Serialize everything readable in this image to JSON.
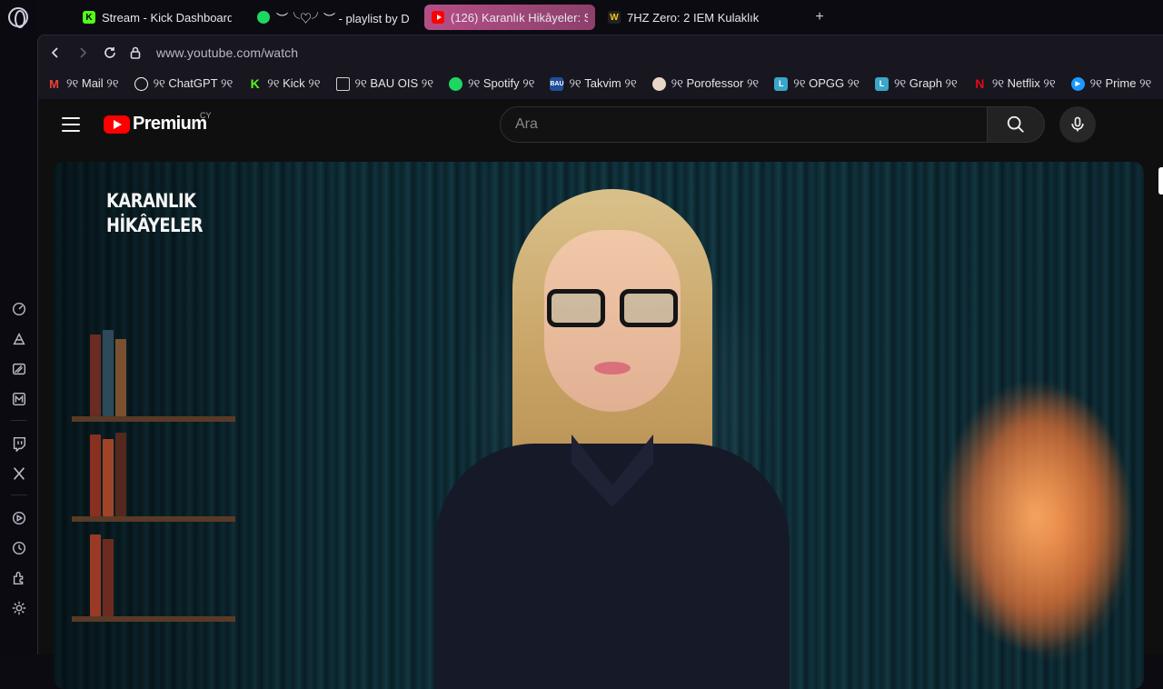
{
  "tabs": [
    {
      "label": "Stream - Kick Dashboard",
      "icon": "kick-icon",
      "active": false
    },
    {
      "label": "︶╰♡╯︶ - playlist by D",
      "icon": "spotify-icon",
      "active": false
    },
    {
      "label": "(126) Karanlık Hikâyeler: S",
      "icon": "youtube-icon",
      "active": true
    },
    {
      "label": "7HZ Zero: 2 IEM Kulaklık",
      "icon": "site-w-icon",
      "active": false
    }
  ],
  "new_tab": "+",
  "address": {
    "url": "www.youtube.com/watch"
  },
  "bookmarks": [
    {
      "label": "୨୧ Mail ୨୧",
      "icon": "gmail-icon",
      "color": "#ea4335"
    },
    {
      "label": "୨୧ ChatGPT ୨୧",
      "icon": "chatgpt-icon",
      "color": "#ffffff"
    },
    {
      "label": "୨୧ Kick ୨୧",
      "icon": "kick-icon",
      "color": "#53fc18"
    },
    {
      "label": "୨୧ BAU OIS ୨୧",
      "icon": "document-icon",
      "color": "#cccccc"
    },
    {
      "label": "୨୧ Spotify ୨୧",
      "icon": "spotify-icon",
      "color": "#1ed760"
    },
    {
      "label": "୨୧ Takvim ୨୧",
      "icon": "bau-icon",
      "color": "#1f4e9c"
    },
    {
      "label": "୨୧ Porofessor ୨୧",
      "icon": "porofessor-icon",
      "color": "#e8d6c8"
    },
    {
      "label": "୨୧ OPGG ୨୧",
      "icon": "l-icon",
      "color": "#3aa6c9"
    },
    {
      "label": "୨୧ Graph ୨୧",
      "icon": "l-icon",
      "color": "#3aa6c9"
    },
    {
      "label": "୨୧ Netflix ୨୧",
      "icon": "netflix-icon",
      "color": "#e50914"
    },
    {
      "label": "୨୧ Prime ୨୧",
      "icon": "prime-icon",
      "color": "#1a98ff"
    },
    {
      "label": "୨୧",
      "icon": "tv-icon",
      "color": "#f5c518"
    }
  ],
  "youtube": {
    "brand": "Premium",
    "country": "CY",
    "search_placeholder": "Ara"
  },
  "video": {
    "watermark_line1": "KARANLIK",
    "watermark_line2": "HİKÂYELER"
  },
  "sidebar_icons": [
    "speed-dial-icon",
    "ai-icon",
    "workspace-icon",
    "messenger-icon",
    "twitch-icon",
    "x-icon",
    "player-icon",
    "history-icon",
    "extensions-icon",
    "settings-icon"
  ]
}
